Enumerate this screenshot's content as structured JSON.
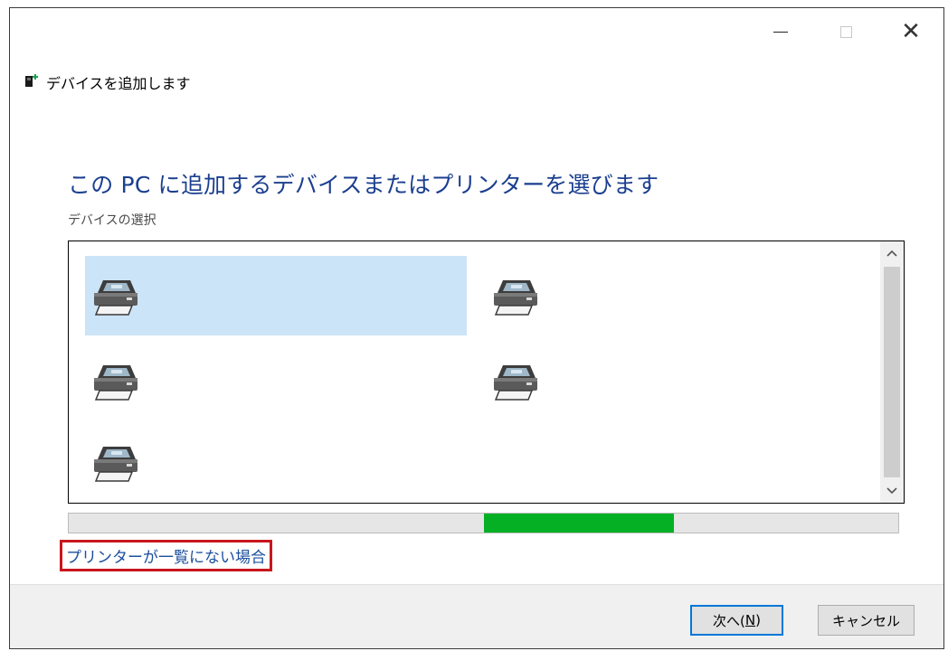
{
  "window": {
    "title": "デバイスを追加します",
    "controls": [
      "minimize-icon",
      "maximize-icon",
      "close-icon"
    ],
    "close_glyph": "✕"
  },
  "main": {
    "heading": "この PC に追加するデバイスまたはプリンターを選びます",
    "subheading": "デバイスの選択",
    "devices": [
      {
        "icon": "printer-icon",
        "selected": true
      },
      {
        "icon": "printer-icon",
        "selected": false
      },
      {
        "icon": "printer-icon",
        "selected": false
      },
      {
        "icon": "printer-icon",
        "selected": false
      },
      {
        "icon": "printer-icon",
        "selected": false
      }
    ],
    "progress": {
      "start_fraction": 0.5,
      "fill_fraction": 0.23,
      "color": "#06b025"
    },
    "not_listed_link": "プリンターが一覧にない場合"
  },
  "footer": {
    "next_label": "次へ(",
    "next_mnemonic": "N",
    "next_close": ")",
    "cancel_label": "キャンセル"
  },
  "colors": {
    "heading": "#1b3f8f",
    "link": "#1b4f9c",
    "highlight_border": "#c8161d",
    "selection": "#cce4f7",
    "default_button_border": "#0078d7"
  }
}
